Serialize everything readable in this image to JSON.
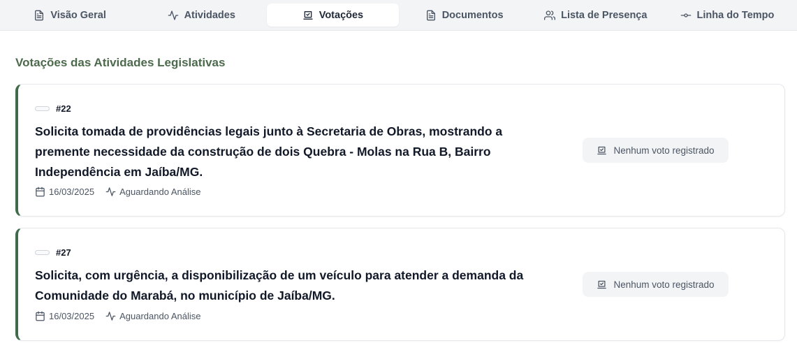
{
  "tabs": [
    {
      "label": "Visão Geral",
      "icon": "document-icon",
      "active": false
    },
    {
      "label": "Atividades",
      "icon": "activity-icon",
      "active": false
    },
    {
      "label": "Votações",
      "icon": "vote-icon",
      "active": true
    },
    {
      "label": "Documentos",
      "icon": "document-icon",
      "active": false
    },
    {
      "label": "Lista de Presença",
      "icon": "users-icon",
      "active": false
    },
    {
      "label": "Linha do Tempo",
      "icon": "commit-icon",
      "active": false
    }
  ],
  "section": {
    "title": "Votações das Atividades Legislativas"
  },
  "items": [
    {
      "number": "#22",
      "title": "Solicita tomada de providências legais junto à Secretaria de Obras, mostrando a premente necessidade da construção de dois Quebra - Molas na Rua B, Bairro Independência em Jaíba/MG.",
      "date": "16/03/2025",
      "status": "Aguardando Análise",
      "vote_status": "Nenhum voto registrado"
    },
    {
      "number": "#27",
      "title": "Solicita, com urgência, a disponibilização de um veículo para atender a demanda da Comunidade do Marabá, no município de Jaíba/MG.",
      "date": "16/03/2025",
      "status": "Aguardando Análise",
      "vote_status": "Nenhum voto registrado"
    }
  ],
  "colors": {
    "accent": "#3f6b4a",
    "section_title": "#4d6a4d",
    "tab_bar": "#f3f4f6"
  }
}
